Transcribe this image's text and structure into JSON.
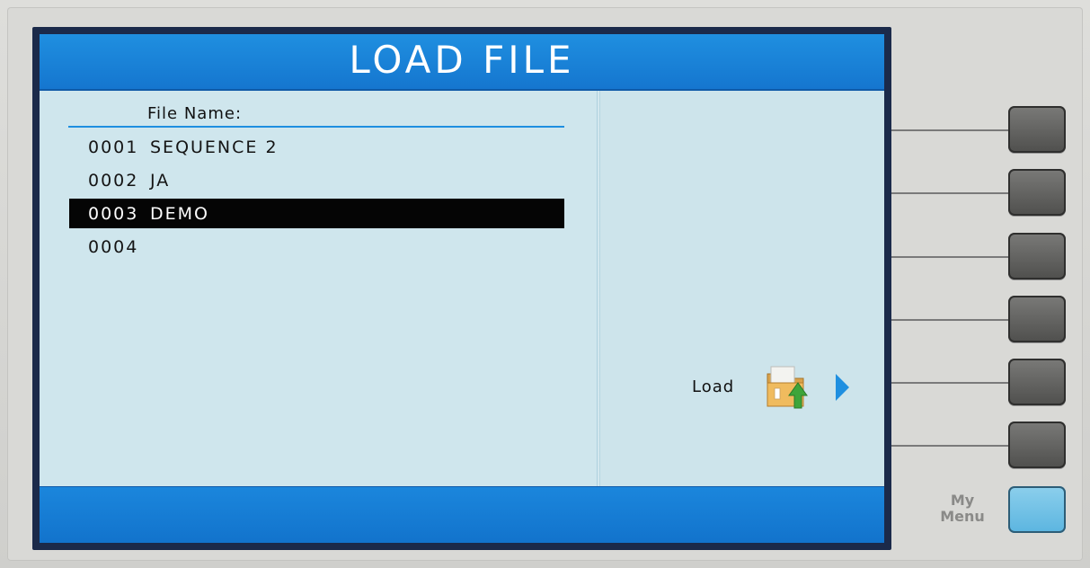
{
  "screen": {
    "title": "LOAD FILE"
  },
  "file_list": {
    "header": "File Name:",
    "rows": [
      {
        "number": "0001",
        "name": "SEQUENCE 2",
        "selected": false
      },
      {
        "number": "0002",
        "name": "JA",
        "selected": false
      },
      {
        "number": "0003",
        "name": "DEMO",
        "selected": true
      },
      {
        "number": "0004",
        "name": "",
        "selected": false
      }
    ]
  },
  "softkeys": {
    "load_label": "Load",
    "load_icon": "folder-load-icon",
    "arrow_icon": "arrow-right-icon"
  },
  "panel": {
    "my_menu_line1": "My",
    "my_menu_line2": "Menu"
  },
  "colors": {
    "title_bar": "#1f8fe0",
    "screen_bg": "#cbe3ea",
    "selection": "#050505",
    "my_menu_key": "#6fc0e6"
  }
}
